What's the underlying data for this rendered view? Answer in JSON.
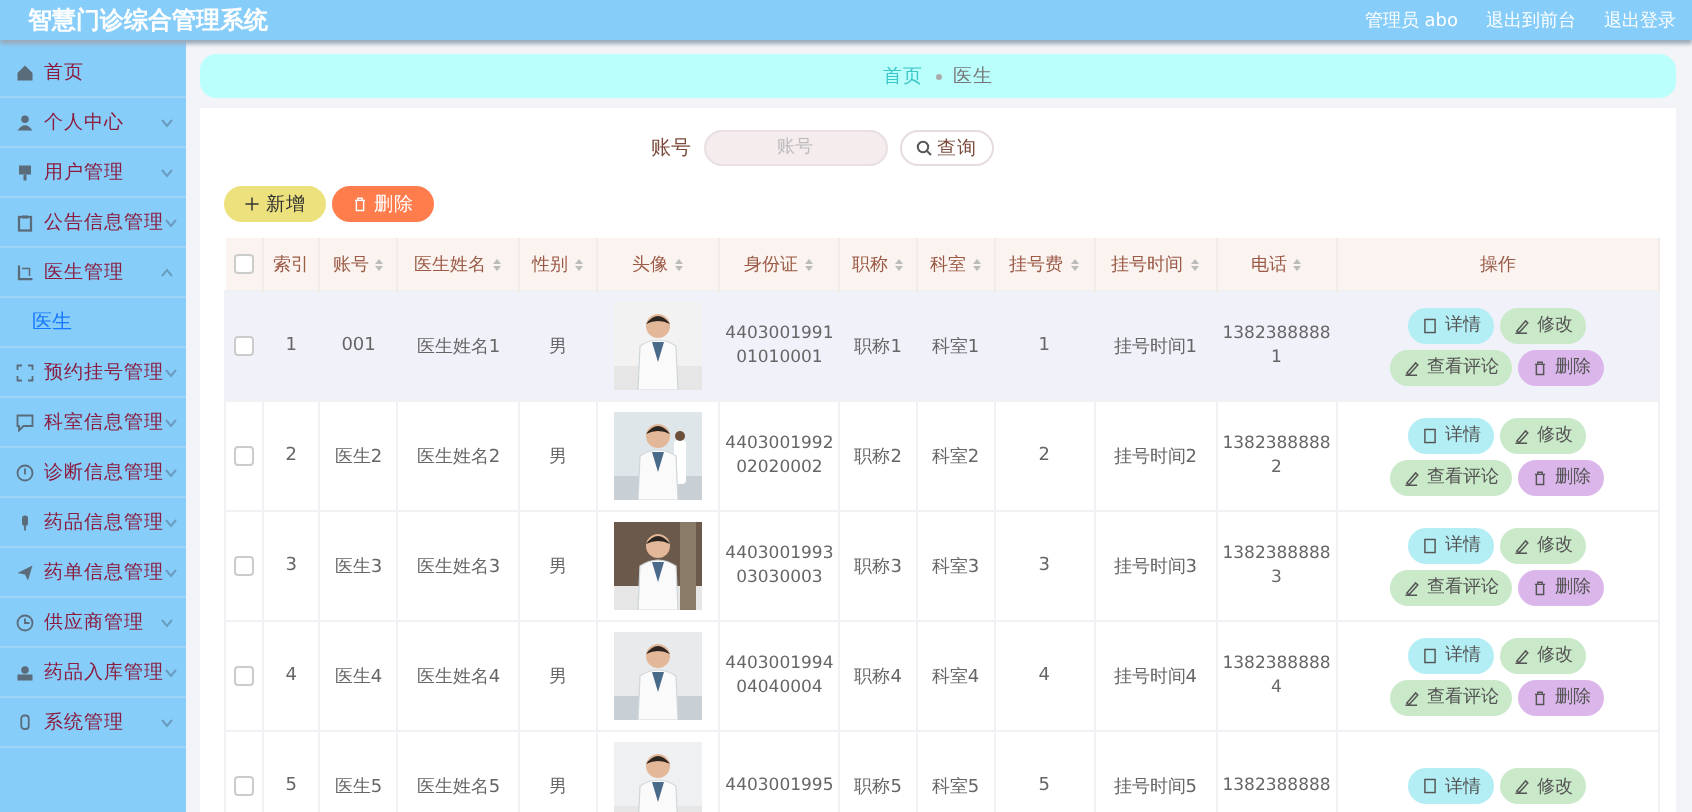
{
  "header": {
    "title": "智慧门诊综合管理系统",
    "user": "管理员 abo",
    "links": [
      "退出到前台",
      "退出登录"
    ]
  },
  "sidebar": {
    "items": [
      {
        "label": "首页",
        "expandable": false
      },
      {
        "label": "个人中心",
        "expandable": true,
        "expanded": false
      },
      {
        "label": "用户管理",
        "expandable": true,
        "expanded": false
      },
      {
        "label": "公告信息管理",
        "expandable": true,
        "expanded": false
      },
      {
        "label": "医生管理",
        "expandable": true,
        "expanded": true,
        "children": [
          {
            "label": "医生",
            "selected": true
          }
        ]
      },
      {
        "label": "预约挂号管理",
        "expandable": true,
        "expanded": false
      },
      {
        "label": "科室信息管理",
        "expandable": true,
        "expanded": false
      },
      {
        "label": "诊断信息管理",
        "expandable": true,
        "expanded": false
      },
      {
        "label": "药品信息管理",
        "expandable": true,
        "expanded": false
      },
      {
        "label": "药单信息管理",
        "expandable": true,
        "expanded": false
      },
      {
        "label": "供应商管理",
        "expandable": true,
        "expanded": false
      },
      {
        "label": "药品入库管理",
        "expandable": true,
        "expanded": false
      },
      {
        "label": "系统管理",
        "expandable": true,
        "expanded": false
      }
    ]
  },
  "breadcrumb": [
    "首页",
    "医生"
  ],
  "search": {
    "label": "账号",
    "placeholder": "账号",
    "button": "查询"
  },
  "toolbar": [
    {
      "label": "新增",
      "kind": "add"
    },
    {
      "label": "删除",
      "kind": "delete"
    }
  ],
  "table": {
    "select_all": {
      "checked": false
    },
    "columns": [
      {
        "label": "索引",
        "sortable": false
      },
      {
        "label": "账号",
        "sortable": true
      },
      {
        "label": "医生姓名",
        "sortable": true
      },
      {
        "label": "性别",
        "sortable": true
      },
      {
        "label": "头像",
        "sortable": true
      },
      {
        "label": "身份证",
        "sortable": true
      },
      {
        "label": "职称",
        "sortable": true
      },
      {
        "label": "科室",
        "sortable": true
      },
      {
        "label": "挂号费",
        "sortable": true
      },
      {
        "label": "挂号时间",
        "sortable": true
      },
      {
        "label": "电话",
        "sortable": true
      },
      {
        "label": "操作",
        "sortable": false
      }
    ],
    "rows": [
      {
        "checked": false,
        "highlighted": true,
        "cells": [
          "1",
          "001",
          "医生姓名1",
          "男",
          {
            "kind": "picture"
          },
          "440300199101010001",
          "职称1",
          "科室1",
          "1",
          "挂号时间1",
          "13823888881"
        ],
        "actions": [
          {
            "label": "详情",
            "kind": "detail"
          },
          {
            "label": "修改",
            "kind": "edit"
          },
          {
            "label": "查看评论",
            "kind": "comments"
          },
          {
            "label": "删除",
            "kind": "delete"
          }
        ]
      },
      {
        "checked": false,
        "highlighted": false,
        "cells": [
          "2",
          "医生2",
          "医生姓名2",
          "男",
          {
            "kind": "picture"
          },
          "440300199202020002",
          "职称2",
          "科室2",
          "2",
          "挂号时间2",
          "13823888882"
        ],
        "actions": [
          {
            "label": "详情",
            "kind": "detail"
          },
          {
            "label": "修改",
            "kind": "edit"
          },
          {
            "label": "查看评论",
            "kind": "comments"
          },
          {
            "label": "删除",
            "kind": "delete"
          }
        ]
      },
      {
        "checked": false,
        "highlighted": false,
        "cells": [
          "3",
          "医生3",
          "医生姓名3",
          "男",
          {
            "kind": "picture"
          },
          "440300199303030003",
          "职称3",
          "科室3",
          "3",
          "挂号时间3",
          "13823888883"
        ],
        "actions": [
          {
            "label": "详情",
            "kind": "detail"
          },
          {
            "label": "修改",
            "kind": "edit"
          },
          {
            "label": "查看评论",
            "kind": "comments"
          },
          {
            "label": "删除",
            "kind": "delete"
          }
        ]
      },
      {
        "checked": false,
        "highlighted": false,
        "cells": [
          "4",
          "医生4",
          "医生姓名4",
          "男",
          {
            "kind": "picture"
          },
          "440300199404040004",
          "职称4",
          "科室4",
          "4",
          "挂号时间4",
          "13823888884"
        ],
        "actions": [
          {
            "label": "详情",
            "kind": "detail"
          },
          {
            "label": "修改",
            "kind": "edit"
          },
          {
            "label": "查看评论",
            "kind": "comments"
          },
          {
            "label": "删除",
            "kind": "delete"
          }
        ]
      },
      {
        "checked": false,
        "highlighted": false,
        "cells": [
          "5",
          "医生5",
          "医生姓名5",
          "男",
          {
            "kind": "picture"
          },
          "4403001995",
          "职称5",
          "科室5",
          "5",
          "挂号时间5",
          "1382388888"
        ],
        "actions": [
          {
            "label": "详情",
            "kind": "detail"
          },
          {
            "label": "修改",
            "kind": "edit"
          }
        ]
      }
    ]
  }
}
